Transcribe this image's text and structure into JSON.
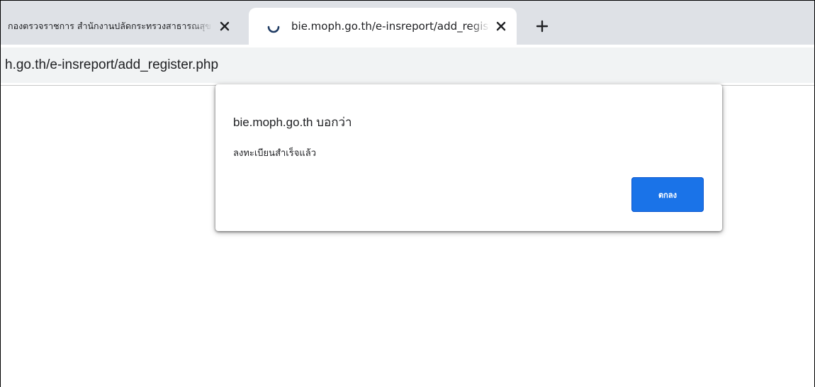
{
  "tabs": [
    {
      "title": "กองตรวจราชการ สำนักงานปลัดกระทรวงสาธารณสุข",
      "active": false
    },
    {
      "title": "bie.moph.go.th/e-insreport/add_register.php",
      "active": true,
      "loading": true
    }
  ],
  "new_tab_icon": "plus-icon",
  "omnibox": {
    "url": "h.go.th/e-insreport/add_register.php"
  },
  "dialog": {
    "title": "bie.moph.go.th บอกว่า",
    "message": "ลงทะเบียนสำเร็จแล้ว",
    "ok_label": "ตกลง"
  },
  "colors": {
    "accent": "#1a73e8",
    "tabstrip": "#dee1e6",
    "spinner": "#1f3b63"
  }
}
